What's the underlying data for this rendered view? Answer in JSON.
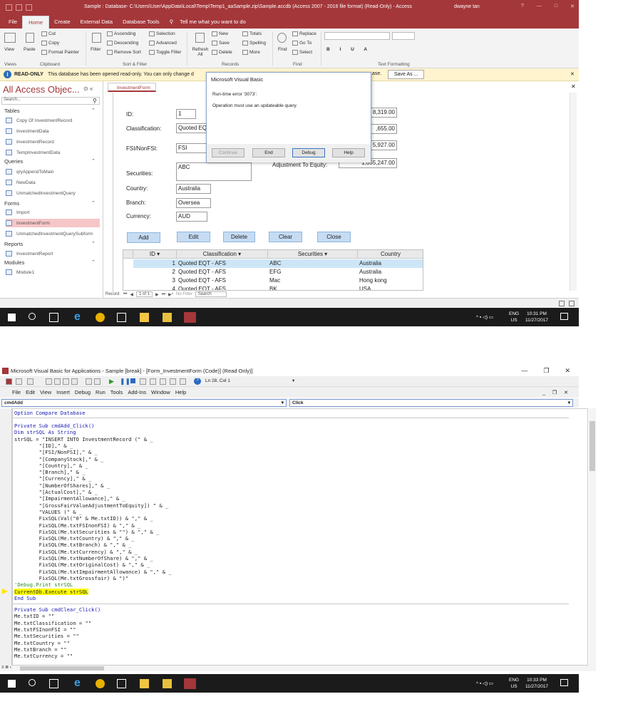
{
  "access": {
    "title": "Sample : Database- C:\\Users\\User\\AppData\\Local\\Temp\\Temp1_aaSample.zip\\Sample.accdb (Access 2007 - 2016 file format) (Read-Only)  -  Access",
    "user": "dwayne tan",
    "tabs": [
      "File",
      "Home",
      "Create",
      "External Data",
      "Database Tools"
    ],
    "tell_me": "Tell me what you want to do",
    "ribbon": {
      "view": "View",
      "paste": "Paste",
      "cut": "Cut",
      "copy": "Copy",
      "format_painter": "Format Painter",
      "filter": "Filter",
      "ascending": "Ascending",
      "descending": "Descending",
      "remove_sort": "Remove Sort",
      "selection": "Selection",
      "advanced": "Advanced",
      "toggle_filter": "Toggle Filter",
      "refresh": "Refresh All",
      "new": "New",
      "save": "Save",
      "delete": "Delete",
      "totals": "Totals",
      "spelling": "Spelling",
      "more": "More",
      "find": "Find",
      "replace": "Replace",
      "goto": "Go To",
      "select": "Select",
      "groups": [
        "Views",
        "Clipboard",
        "Sort & Filter",
        "Records",
        "Find",
        "Text Formatting"
      ]
    },
    "message_bar": {
      "label": "READ-ONLY",
      "text": "This database has been opened read-only. You can only change d",
      "tail": "ase.",
      "save_as": "Save As ..."
    },
    "nav": {
      "title": "All Access Objec...",
      "search_placeholder": "Search...",
      "sections": [
        {
          "name": "Tables",
          "items": [
            "Copy Of InvestmentRecord",
            "InvestmentData",
            "InvestmentRecord",
            "TempInvestmentData"
          ]
        },
        {
          "name": "Queries",
          "items": [
            "qryAppendToMain",
            "NewData",
            "UnmatchedInvestmentQuery"
          ]
        },
        {
          "name": "Forms",
          "items": [
            "Import",
            "InvestmentForm",
            "UnmatchedInvestmentQuerySubform"
          ]
        },
        {
          "name": "Reports",
          "items": [
            "InvestmentReport"
          ]
        },
        {
          "name": "Modules",
          "items": [
            "Module1"
          ]
        }
      ]
    },
    "form": {
      "tab": "InvestmentForm",
      "labels": {
        "id": "ID:",
        "classification": "Classification:",
        "fsi": "FSI/NonFSI:",
        "securities": "Securities:",
        "country": "Country:",
        "branch": "Branch:",
        "currency": "Currency:",
        "adjustment": "Adjustment To Equity:"
      },
      "values": {
        "id": "1",
        "classification": "Quoted EQ",
        "fsi": "FSI",
        "securities": "ABC",
        "country": "Australia",
        "branch": "Oversea",
        "currency": "AUD",
        "v1": "8,319.00",
        "v2": ",655.00",
        "v3": "5,927.00",
        "adjustment": "1,055,247.00"
      },
      "buttons": [
        "Add",
        "Edit",
        "Delete",
        "Clear",
        "Close"
      ],
      "grid": {
        "headers": [
          "ID",
          "Classification",
          "Securities",
          "Country"
        ],
        "rows": [
          [
            "1",
            "Quoted EQT - AFS",
            "ABC",
            "Australia"
          ],
          [
            "2",
            "Quoted EQT - AFS",
            "EFG",
            "Australia"
          ],
          [
            "3",
            "Quoted EQT - AFS",
            "Mac",
            "Hong kong"
          ],
          [
            "4",
            "Quoted EQT - AFS",
            "BK",
            "USA"
          ]
        ]
      },
      "record_nav": {
        "label": "Record:",
        "position": "1 of 1",
        "no_filter": "No Filter",
        "search": "Search"
      }
    },
    "dialog": {
      "title": "Microsoft Visual Basic",
      "error": "Run-time error '3073':",
      "message": "Operation must use an updateable query.",
      "buttons": [
        "Continue",
        "End",
        "Debug",
        "Help"
      ]
    }
  },
  "taskbar1": {
    "lang": "ENG",
    "region": "US",
    "time": "10:31 PM",
    "date": "11/27/2017"
  },
  "vba": {
    "title": "Microsoft Visual Basic for Applications - Sample [break] - [Form_InvestmentForm (Code)]  (Read Only)]",
    "position": "Ln 28, Col 1",
    "menu": [
      "File",
      "Edit",
      "View",
      "Insert",
      "Debug",
      "Run",
      "Tools",
      "Add-Ins",
      "Window",
      "Help"
    ],
    "object_combo": "cmdAdd",
    "proc_combo": "Click",
    "code_top": "Option Compare Database",
    "code_block1": [
      "Private Sub cmdAdd_Click()",
      "Dim strSQL As String",
      "strSQL = \"INSERT INTO InvestmentRecord (\" & _",
      "        \"[ID],\" & _",
      "        \"[FSI/NonFSI],\" & _",
      "        \"[CompanyStock],\" & _",
      "        \"[Country],\" & _",
      "        \"[Branch],\" & _",
      "        \"[Currency],\" & _",
      "        \"[NumberOfShares],\" & _",
      "        \"[ActualCost],\" & _",
      "        \"[ImpairmentAllowance],\" & _",
      "        \"[GrossFairValueAdjustmentToEquity]) \" & _",
      "        \"VALUES (\" & _",
      "        FixSQL(Val(\"0\" & Me.txtID)) & \",\" & _",
      "        FixSQL(Me.txtFSInonFSI) & \",\" & _",
      "        FixSQL(Me.txtSecurities & \"\") & \",\" & _",
      "        FixSQL(Me.txtCountry) & \",\" & _",
      "        FixSQL(Me.txtBranch) & \",\" & _",
      "        FixSQL(Me.txtCurrency) & \",\" & _",
      "        FixSQL(Me.txtNumberOfShare) & \",\" & _",
      "        FixSQL(Me.txtOriginalCost) & \",\" & _",
      "        FixSQL(Me.txtImpairmentAllowance) & \",\" & _",
      "        FixSQL(Me.txtGrossfair) & \")\""
    ],
    "comment_line": "'Debug.Print strSQL",
    "highlight_line": "CurrentDb.Execute strSQL",
    "end_sub": "End Sub",
    "code_block2": [
      "Private Sub cmdClear_Click()",
      "Me.txtID = \"\"",
      "Me.txtClassification = \"\"",
      "Me.txtFSInonFSI = \"\"",
      "Me.txtSecurities = \"\"",
      "Me.txtCountry = \"\"",
      "Me.txtBranch = \"\"",
      "Me.txtCurrency = \"\""
    ]
  },
  "taskbar2": {
    "lang": "ENG",
    "region": "US",
    "time": "10:33 PM",
    "date": "11/27/2017"
  },
  "colors": {
    "access_red": "#a4373a",
    "info_yellow": "#fff4ce",
    "highlight": "#ffff00",
    "keyword": "#1a1ab5",
    "comment": "#2e8b2e"
  }
}
